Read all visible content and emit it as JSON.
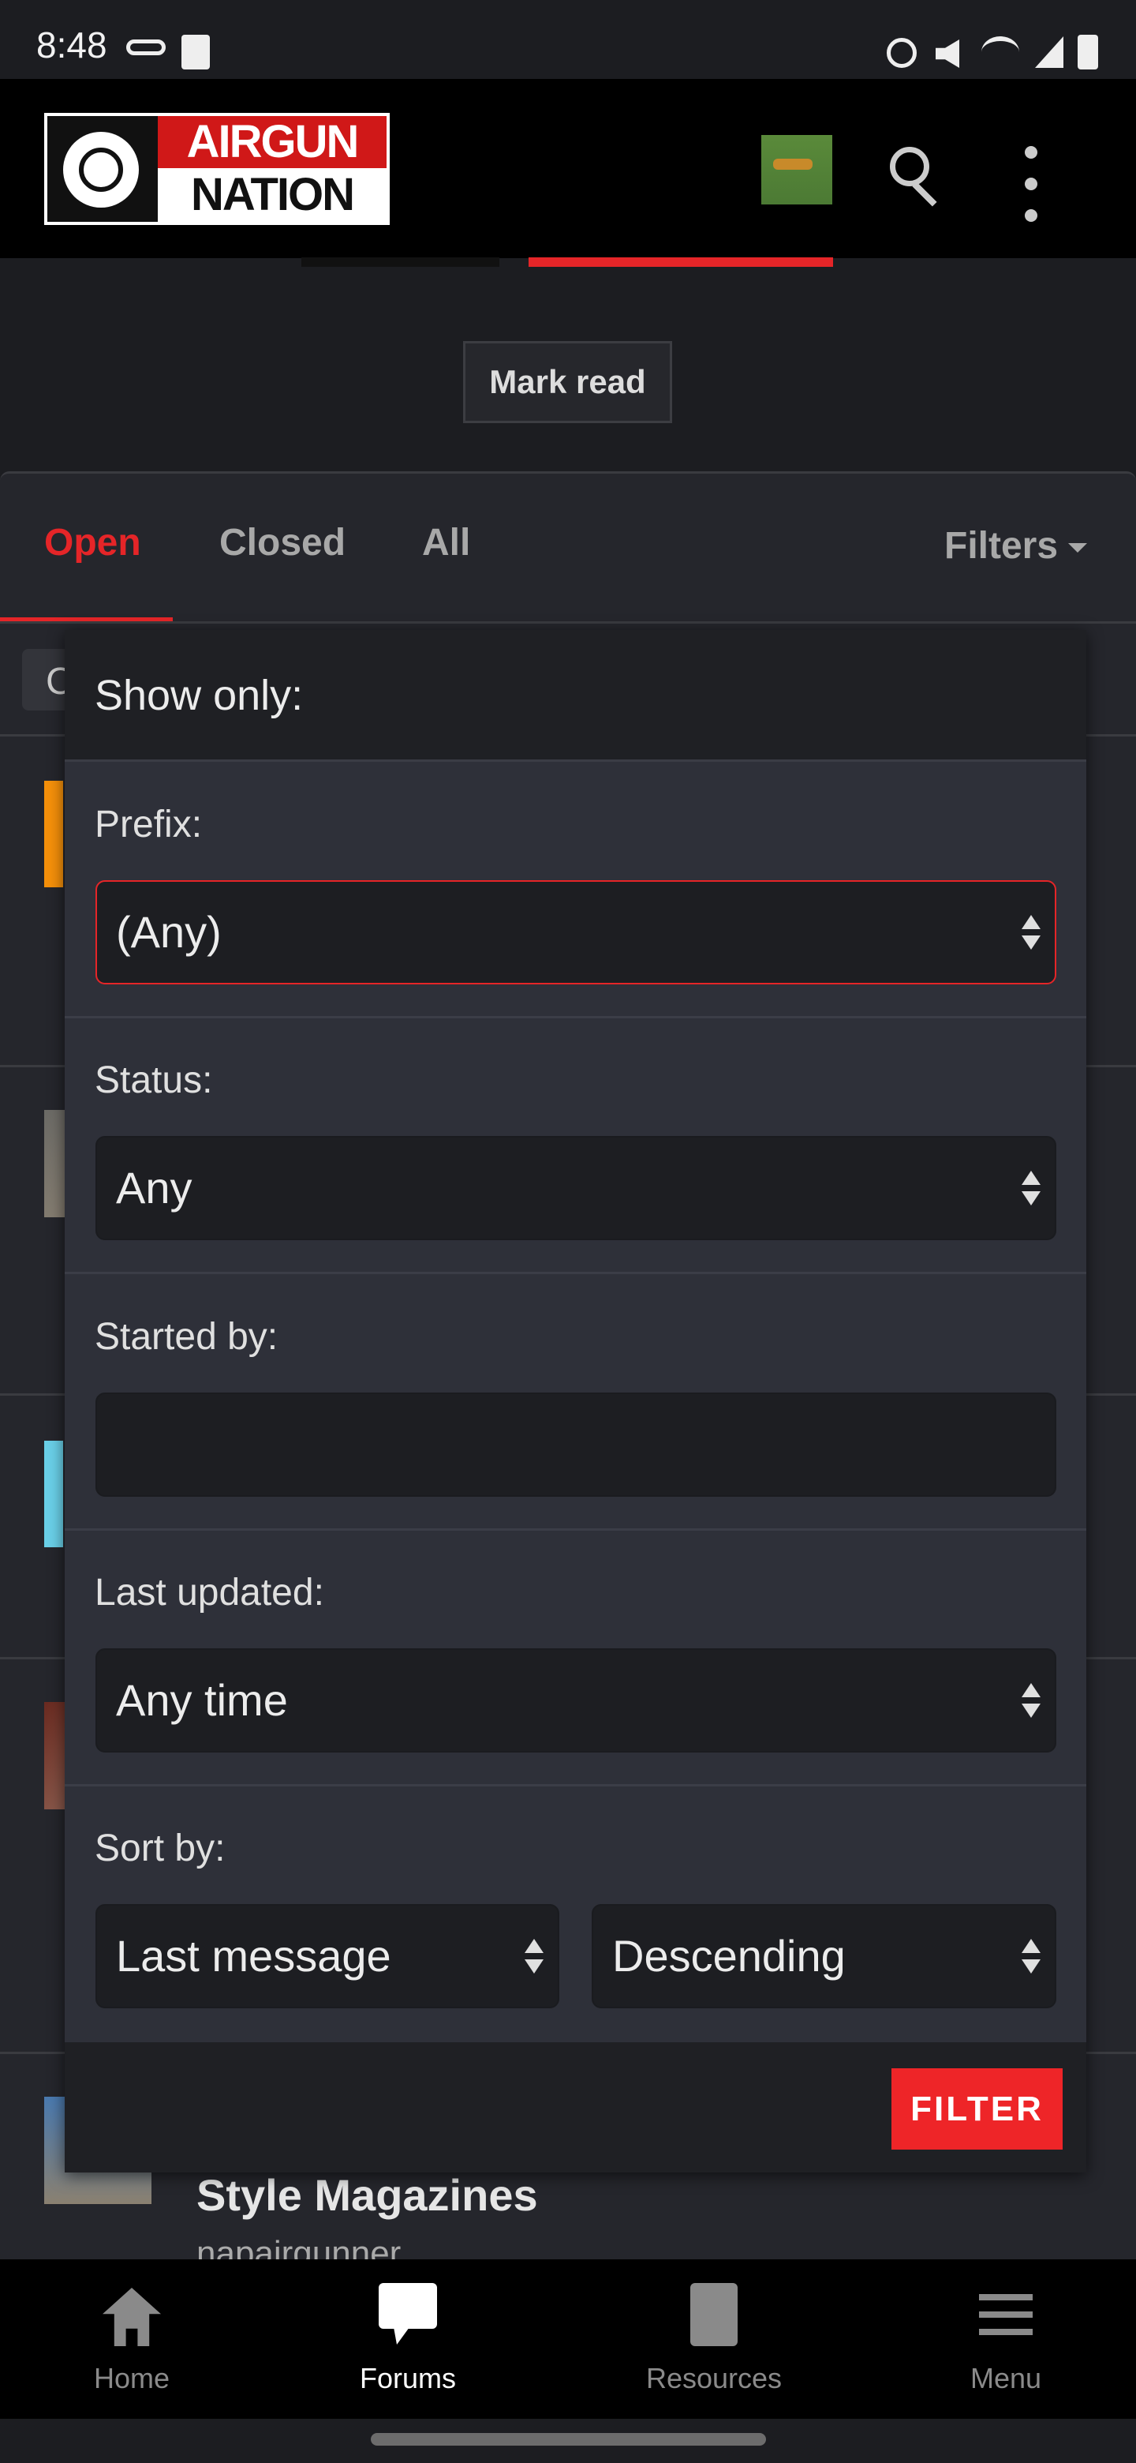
{
  "status_bar": {
    "time": "8:48",
    "icons": [
      "voicemail-icon",
      "clock-app-icon",
      "alarm-icon",
      "mute-icon",
      "wifi-icon",
      "signal-icon",
      "battery-icon"
    ]
  },
  "header": {
    "logo_top": "AIRGUN",
    "logo_bottom": "NATION",
    "icons": [
      "avatar",
      "search-icon",
      "more-vertical-icon"
    ]
  },
  "mark_read": "Mark read",
  "tabs": [
    {
      "label": "Open",
      "active": true
    },
    {
      "label": "Closed"
    },
    {
      "label": "All"
    }
  ],
  "filters_label": "Filters",
  "chip_text": "C",
  "filter_menu": {
    "title": "Show only:",
    "prefix": {
      "label": "Prefix:",
      "value": "(Any)"
    },
    "status": {
      "label": "Status:",
      "value": "Any"
    },
    "started_by": {
      "label": "Started by:",
      "value": ""
    },
    "last_updated": {
      "label": "Last updated:",
      "value": "Any time"
    },
    "sort_by": {
      "label": "Sort by:",
      "field": "Last message",
      "direction": "Descending"
    },
    "submit": "FILTER"
  },
  "background_thread": {
    "title": "Style Magazines",
    "author": "napairgunner"
  },
  "bottom_nav": [
    {
      "label": "Home",
      "icon": "home-icon"
    },
    {
      "label": "Forums",
      "icon": "forums-icon",
      "active": true
    },
    {
      "label": "Resources",
      "icon": "resources-icon"
    },
    {
      "label": "Menu",
      "icon": "menu-icon"
    }
  ],
  "colors": {
    "accent": "#ee2528",
    "background": "#1c1d21",
    "panel": "#2e3039"
  }
}
